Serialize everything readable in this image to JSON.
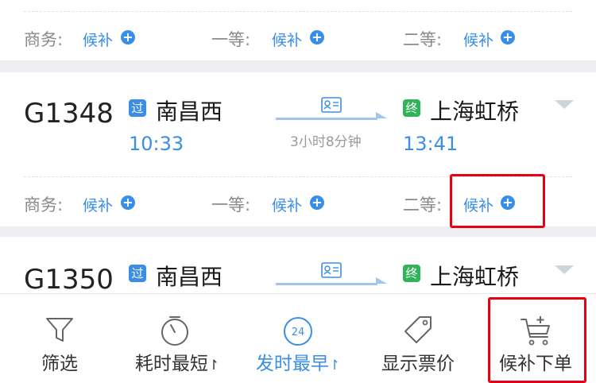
{
  "trains": [
    {
      "seats": [
        {
          "label": "商务:",
          "status": "候补"
        },
        {
          "label": "一等:",
          "status": "候补"
        },
        {
          "label": "二等:",
          "status": "候补"
        }
      ]
    },
    {
      "number": "G1348",
      "from_badge": "过",
      "from_station": "南昌西",
      "depart": "10:33",
      "duration": "3小时8分钟",
      "to_badge": "终",
      "to_station": "上海虹桥",
      "arrive": "13:41",
      "seats": [
        {
          "label": "商务:",
          "status": "候补"
        },
        {
          "label": "一等:",
          "status": "候补"
        },
        {
          "label": "二等:",
          "status": "候补"
        }
      ]
    },
    {
      "number": "G1350",
      "from_badge": "过",
      "from_station": "南昌西",
      "to_badge": "终",
      "to_station": "上海虹桥"
    }
  ],
  "tabbar": {
    "filter": "筛选",
    "shortest": "耗时最短",
    "earliest": "发时最早",
    "earliest_icon_text": "24",
    "show_price": "显示票价",
    "waitlist_order": "候补下单"
  },
  "colors": {
    "accent_blue": "#3a8ee6",
    "pass_badge": "#3a8ee6",
    "terminal_badge": "#2fb45a",
    "highlight_red": "#e60012"
  },
  "icons": {
    "filter": "funnel-icon",
    "shortest": "stopwatch-icon",
    "earliest": "clock-24-icon",
    "show_price": "price-tag-icon",
    "waitlist_order": "cart-add-icon",
    "id_card": "id-card-icon",
    "expand": "chevron-down-icon",
    "add": "plus-circle-icon"
  }
}
